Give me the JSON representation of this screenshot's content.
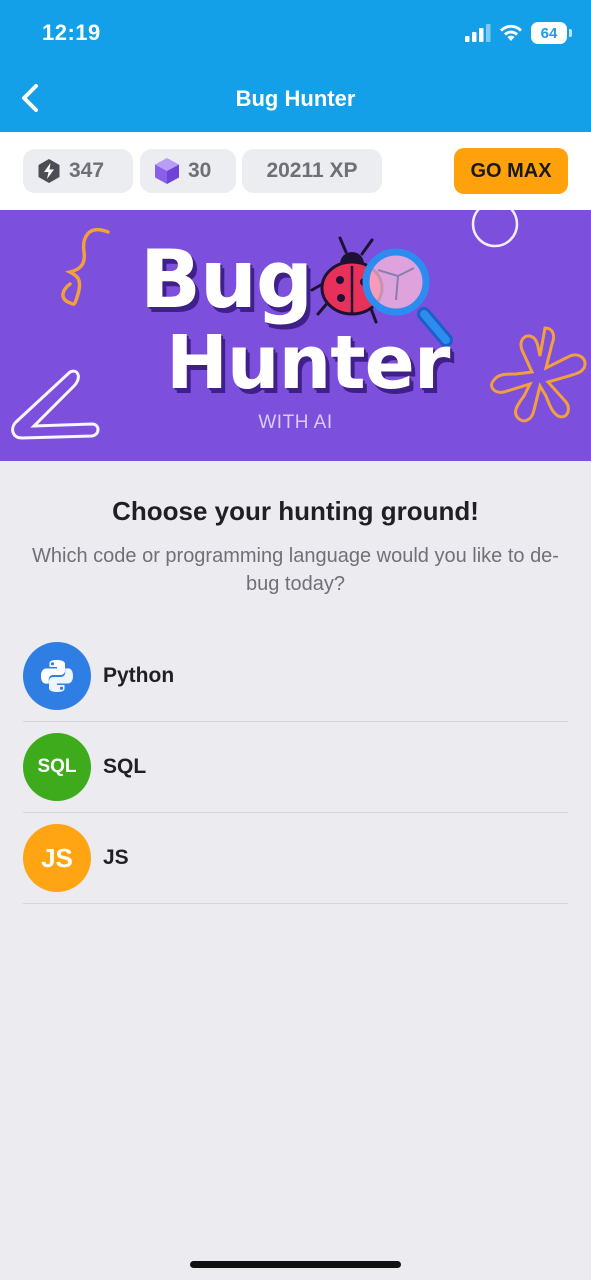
{
  "status_bar": {
    "time": "12:19",
    "battery": "64"
  },
  "nav": {
    "title": "Bug Hunter",
    "back_icon": "chevron-left-icon"
  },
  "stats": {
    "energy": {
      "icon": "bolt-shield-icon",
      "value": "347"
    },
    "gems": {
      "icon": "cube-icon",
      "value": "30"
    },
    "xp": {
      "label": "20211 XP"
    },
    "go_max_label": "GO MAX"
  },
  "banner": {
    "line1": "Bug",
    "line2": "Hunter",
    "subtitle": "WITH AI"
  },
  "content": {
    "heading": "Choose your hunting ground!",
    "subheading": "Which code or programming language would you like to de-bug today?"
  },
  "languages": [
    {
      "name": "Python",
      "badge": "",
      "icon": "python-icon",
      "color": "#2f7ee3"
    },
    {
      "name": "SQL",
      "badge": "SQL",
      "icon": "sql-badge",
      "color": "#3dab1b"
    },
    {
      "name": "JS",
      "badge": "JS",
      "icon": "js-badge",
      "color": "#ffa412"
    }
  ],
  "colors": {
    "primary": "#13a0e8",
    "banner": "#7c4fdc",
    "accent": "#ffa10a"
  }
}
